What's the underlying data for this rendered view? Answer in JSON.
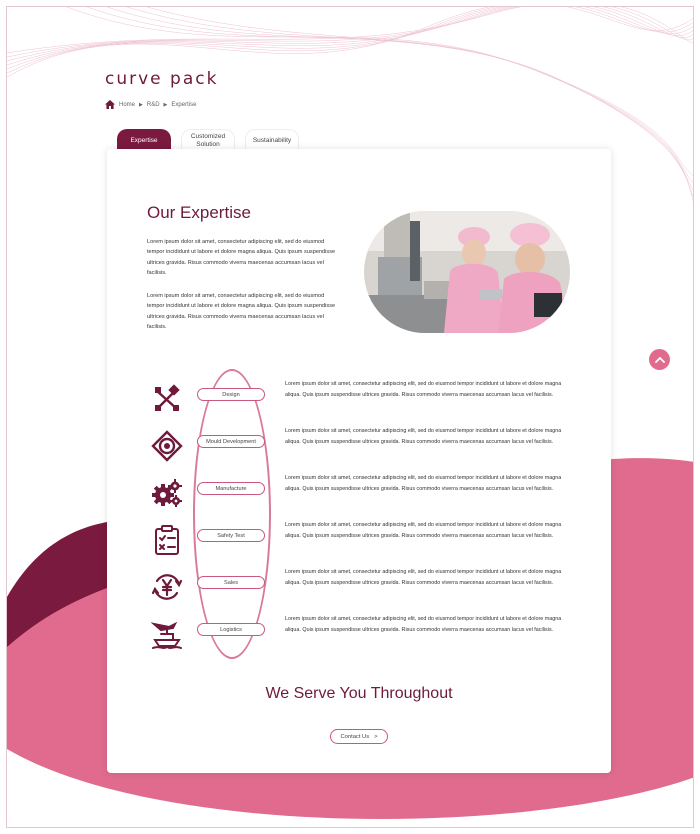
{
  "brand": {
    "logo_text": "curve pack"
  },
  "breadcrumb": {
    "items": [
      "Home",
      "R&D",
      "Expertise"
    ],
    "separator": "▶"
  },
  "tabs": [
    {
      "label": "Expertise",
      "active": true
    },
    {
      "label": "Customized Solution",
      "active": false
    },
    {
      "label": "Sustainability",
      "active": false
    }
  ],
  "expertise": {
    "title": "Our Expertise",
    "paragraphs": [
      "Lorem ipsum dolor sit amet, consectetur adipiscing elit, sed do eiusmod tempor incididunt ut labore et dolore magna aliqua. Quis ipsum suspendisse ultrices gravida. Risus commodo viverra maecenas accumsan lacus vel facilisis.",
      "Lorem ipsum dolor sit amet, consectetur adipiscing elit, sed do eiusmod tempor incididunt ut labore et dolore magna aliqua. Quis ipsum suspendisse ultrices gravida. Risus commodo viverra maecenas accumsan lacus vel facilisis."
    ]
  },
  "steps": [
    {
      "label": "Design",
      "icon": "design-tools-icon",
      "text": "Lorem ipsum dolor sit amet, consectetur adipiscing elit, sed do eiusmod tempor incididunt ut labore et dolore magna aliqua. Quis ipsum suspendisse ultrices gravida. Risus commodo viverra maecenas accumsan lacus vel facilisis."
    },
    {
      "label": "Mould Development",
      "icon": "target-icon",
      "text": "Lorem ipsum dolor sit amet, consectetur adipiscing elit, sed do eiusmod tempor incididunt ut labore et dolore magna aliqua. Quis ipsum suspendisse ultrices gravida. Risus commodo viverra maecenas accumsan lacus vel facilisis."
    },
    {
      "label": "Manufacture",
      "icon": "gears-icon",
      "text": "Lorem ipsum dolor sit amet, consectetur adipiscing elit, sed do eiusmod tempor incididunt ut labore et dolore magna aliqua. Quis ipsum suspendisse ultrices gravida. Risus commodo viverra maecenas accumsan lacus vel facilisis."
    },
    {
      "label": "Safety Test",
      "icon": "clipboard-check-icon",
      "text": "Lorem ipsum dolor sit amet, consectetur adipiscing elit, sed do eiusmod tempor incididunt ut labore et dolore magna aliqua. Quis ipsum suspendisse ultrices gravida. Risus commodo viverra maecenas accumsan lacus vel facilisis."
    },
    {
      "label": "Sales",
      "icon": "yen-cycle-icon",
      "text": "Lorem ipsum dolor sit amet, consectetur adipiscing elit, sed do eiusmod tempor incididunt ut labore et dolore magna aliqua. Quis ipsum suspendisse ultrices gravida. Risus commodo viverra maecenas accumsan lacus vel facilisis."
    },
    {
      "label": "Logistics",
      "icon": "ship-plane-icon",
      "text": "Lorem ipsum dolor sit amet, consectetur adipiscing elit, sed do eiusmod tempor incididunt ut labore et dolore magna aliqua. Quis ipsum suspendisse ultrices gravida. Risus commodo viverra maecenas accumsan lacus vel facilisis."
    }
  ],
  "serve": {
    "title": "We Serve You Throughout",
    "contact_label": "Contact Us",
    "contact_arrow": ">"
  },
  "colors": {
    "brand_dark": "#6e1a3c",
    "brand_pink": "#e06b8e",
    "tab_active": "#7a1a3e"
  }
}
